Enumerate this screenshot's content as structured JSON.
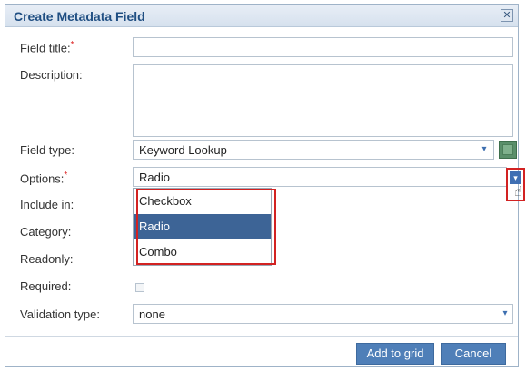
{
  "dialog": {
    "title": "Create Metadata Field",
    "close_glyph": "✕"
  },
  "form": {
    "field_title": {
      "label": "Field title:",
      "required_mark": "*",
      "value": ""
    },
    "description": {
      "label": "Description:",
      "value": ""
    },
    "field_type": {
      "label": "Field type:",
      "value": "Keyword Lookup"
    },
    "options": {
      "label": "Options:",
      "required_mark": "*",
      "value": "Radio",
      "items": [
        "Checkbox",
        "Radio",
        "Combo"
      ],
      "selected_index": 1
    },
    "include_in": {
      "label": "Include in:"
    },
    "category": {
      "label": "Category:"
    },
    "readonly": {
      "label": "Readonly:"
    },
    "required": {
      "label": "Required:",
      "checked": false
    },
    "validation_type": {
      "label": "Validation type:",
      "value": "none"
    }
  },
  "buttons": {
    "add_to_grid": "Add to grid",
    "cancel": "Cancel"
  },
  "icons": {
    "chevron_down": "▾",
    "cursor": "☝"
  },
  "colors": {
    "title": "#1f4e82",
    "button": "#4f7fb8",
    "selection": "#3d6496",
    "highlight_border": "#d22222",
    "required": "#dd2222"
  }
}
